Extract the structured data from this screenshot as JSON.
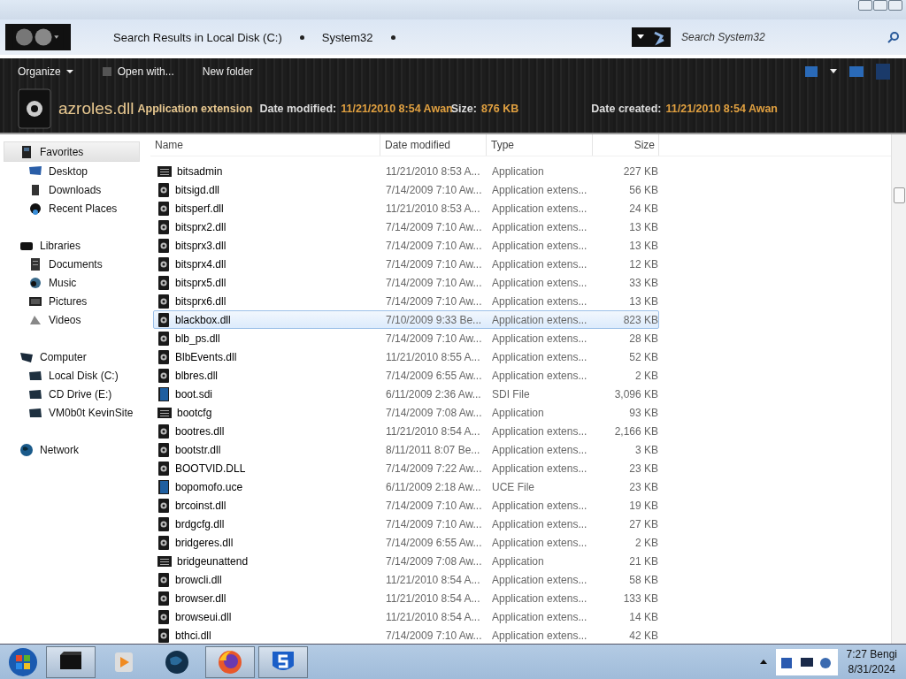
{
  "address_bar": {
    "crumbs": [
      "Search Results in Local Disk (C:)",
      "System32"
    ],
    "search": {
      "placeholder": "Search System32"
    }
  },
  "toolbar": {
    "buttons": [
      {
        "label": "Organize",
        "kind": "menu"
      },
      {
        "label": "Open with...",
        "kind": "icon"
      },
      {
        "label": "New folder",
        "kind": "plain"
      }
    ]
  },
  "details": {
    "filename": "azroles.dll",
    "type": "Application extension",
    "fields": [
      {
        "label": "Date modified:",
        "value": "11/21/2010 8:54 Awan"
      },
      {
        "label": "Size:",
        "value": "876 KB"
      },
      {
        "label": "Date created:",
        "value": "11/21/2010 8:54 Awan"
      }
    ]
  },
  "sidebar": {
    "items": [
      {
        "label": "Favorites",
        "selected": true,
        "children": [
          {
            "label": "Desktop",
            "selected": false
          },
          {
            "label": "Downloads",
            "selected": false
          },
          {
            "label": "Recent Places",
            "selected": false
          }
        ]
      },
      {
        "label": "Libraries",
        "selected": false,
        "children": [
          {
            "label": "Documents",
            "selected": false
          },
          {
            "label": "Music",
            "selected": false
          },
          {
            "label": "Pictures",
            "selected": false
          },
          {
            "label": "Videos",
            "selected": false
          }
        ]
      },
      {
        "label": "Computer",
        "selected": false,
        "children": [
          {
            "label": "Local Disk (C:)",
            "selected": false
          },
          {
            "label": "CD Drive (E:)",
            "selected": false
          },
          {
            "label": "VM0b0t KevinSite",
            "selected": false
          }
        ]
      },
      {
        "label": "Network",
        "selected": false
      }
    ]
  },
  "table": {
    "columns": [
      "Name",
      "Date modified",
      "Type",
      "Size"
    ],
    "rows": [
      {
        "name": "bitsadmin",
        "date": "11/21/2010 8:53 A...",
        "type": "Application",
        "size": "227 KB",
        "kind": "app",
        "selected": false
      },
      {
        "name": "bitsigd.dll",
        "date": "7/14/2009 7:10 Aw...",
        "type": "Application extens...",
        "size": "56 KB",
        "kind": "dll",
        "selected": false
      },
      {
        "name": "bitsperf.dll",
        "date": "11/21/2010 8:53 A...",
        "type": "Application extens...",
        "size": "24 KB",
        "kind": "dll",
        "selected": false
      },
      {
        "name": "bitsprx2.dll",
        "date": "7/14/2009 7:10 Aw...",
        "type": "Application extens...",
        "size": "13 KB",
        "kind": "dll",
        "selected": false
      },
      {
        "name": "bitsprx3.dll",
        "date": "7/14/2009 7:10 Aw...",
        "type": "Application extens...",
        "size": "13 KB",
        "kind": "dll",
        "selected": false
      },
      {
        "name": "bitsprx4.dll",
        "date": "7/14/2009 7:10 Aw...",
        "type": "Application extens...",
        "size": "12 KB",
        "kind": "dll",
        "selected": false
      },
      {
        "name": "bitsprx5.dll",
        "date": "7/14/2009 7:10 Aw...",
        "type": "Application extens...",
        "size": "33 KB",
        "kind": "dll",
        "selected": false
      },
      {
        "name": "bitsprx6.dll",
        "date": "7/14/2009 7:10 Aw...",
        "type": "Application extens...",
        "size": "13 KB",
        "kind": "dll",
        "selected": false
      },
      {
        "name": "blackbox.dll",
        "date": "7/10/2009 9:33 Be...",
        "type": "Application extens...",
        "size": "823 KB",
        "kind": "dll",
        "selected": true
      },
      {
        "name": "blb_ps.dll",
        "date": "7/14/2009 7:10 Aw...",
        "type": "Application extens...",
        "size": "28 KB",
        "kind": "dll",
        "selected": false
      },
      {
        "name": "BlbEvents.dll",
        "date": "11/21/2010 8:55 A...",
        "type": "Application extens...",
        "size": "52 KB",
        "kind": "dll",
        "selected": false
      },
      {
        "name": "blbres.dll",
        "date": "7/14/2009 6:55 Aw...",
        "type": "Application extens...",
        "size": "2 KB",
        "kind": "dll",
        "selected": false
      },
      {
        "name": "boot.sdi",
        "date": "6/11/2009 2:36 Aw...",
        "type": "SDI File",
        "size": "3,096 KB",
        "kind": "file",
        "selected": false
      },
      {
        "name": "bootcfg",
        "date": "7/14/2009 7:08 Aw...",
        "type": "Application",
        "size": "93 KB",
        "kind": "app",
        "selected": false
      },
      {
        "name": "bootres.dll",
        "date": "11/21/2010 8:54 A...",
        "type": "Application extens...",
        "size": "2,166 KB",
        "kind": "dll",
        "selected": false
      },
      {
        "name": "bootstr.dll",
        "date": "8/11/2011 8:07 Be...",
        "type": "Application extens...",
        "size": "3 KB",
        "kind": "dll",
        "selected": false
      },
      {
        "name": "BOOTVID.DLL",
        "date": "7/14/2009 7:22 Aw...",
        "type": "Application extens...",
        "size": "23 KB",
        "kind": "dll",
        "selected": false
      },
      {
        "name": "bopomofo.uce",
        "date": "6/11/2009 2:18 Aw...",
        "type": "UCE File",
        "size": "23 KB",
        "kind": "file",
        "selected": false
      },
      {
        "name": "brcoinst.dll",
        "date": "7/14/2009 7:10 Aw...",
        "type": "Application extens...",
        "size": "19 KB",
        "kind": "dll",
        "selected": false
      },
      {
        "name": "brdgcfg.dll",
        "date": "7/14/2009 7:10 Aw...",
        "type": "Application extens...",
        "size": "27 KB",
        "kind": "dll",
        "selected": false
      },
      {
        "name": "bridgeres.dll",
        "date": "7/14/2009 6:55 Aw...",
        "type": "Application extens...",
        "size": "2 KB",
        "kind": "dll",
        "selected": false
      },
      {
        "name": "bridgeunattend",
        "date": "7/14/2009 7:08 Aw...",
        "type": "Application",
        "size": "21 KB",
        "kind": "app",
        "selected": false
      },
      {
        "name": "browcli.dll",
        "date": "11/21/2010 8:54 A...",
        "type": "Application extens...",
        "size": "58 KB",
        "kind": "dll",
        "selected": false
      },
      {
        "name": "browser.dll",
        "date": "11/21/2010 8:54 A...",
        "type": "Application extens...",
        "size": "133 KB",
        "kind": "dll",
        "selected": false
      },
      {
        "name": "browseui.dll",
        "date": "11/21/2010 8:54 A...",
        "type": "Application extens...",
        "size": "14 KB",
        "kind": "dll",
        "selected": false
      },
      {
        "name": "bthci.dll",
        "date": "7/14/2009 7:10 Aw...",
        "type": "Application extens...",
        "size": "42 KB",
        "kind": "dll",
        "selected": false
      }
    ]
  },
  "taskbar": {
    "apps": [
      {
        "kind": "box",
        "active": true
      },
      {
        "kind": "media",
        "active": false
      },
      {
        "kind": "globe",
        "active": false
      },
      {
        "kind": "firefox",
        "active": true
      },
      {
        "kind": "s",
        "active": true
      }
    ],
    "clock": {
      "time": "7:27 Bengi",
      "date": "8/31/2024"
    }
  }
}
